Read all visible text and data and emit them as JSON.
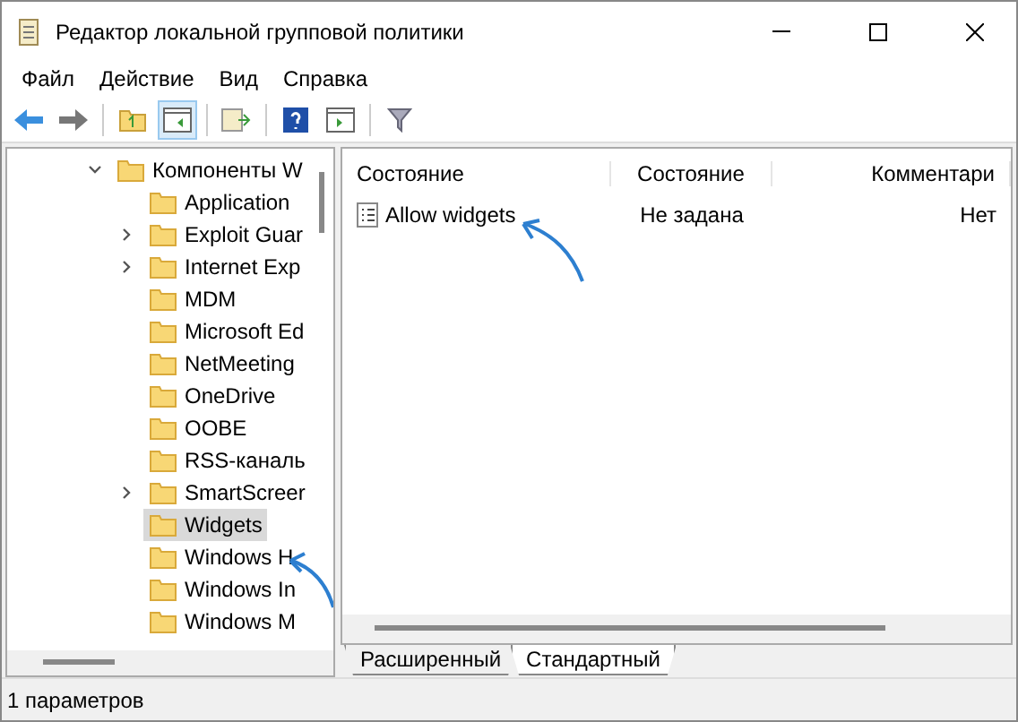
{
  "window": {
    "title": "Редактор локальной групповой политики"
  },
  "menu": [
    "Файл",
    "Действие",
    "Вид",
    "Справка"
  ],
  "tree": {
    "label": "Компоненты W",
    "expanded": true,
    "children": [
      {
        "label": "Application",
        "expandable": false,
        "selected": false
      },
      {
        "label": "Exploit Guar",
        "expandable": true,
        "selected": false
      },
      {
        "label": "Internet Exp",
        "expandable": true,
        "selected": false
      },
      {
        "label": "MDM",
        "expandable": false,
        "selected": false
      },
      {
        "label": "Microsoft Ed",
        "expandable": false,
        "selected": false
      },
      {
        "label": "NetMeeting",
        "expandable": false,
        "selected": false
      },
      {
        "label": "OneDrive",
        "expandable": false,
        "selected": false
      },
      {
        "label": "OOBE",
        "expandable": false,
        "selected": false
      },
      {
        "label": "RSS-каналь",
        "expandable": false,
        "selected": false
      },
      {
        "label": "SmartScreer",
        "expandable": true,
        "selected": false
      },
      {
        "label": "Widgets",
        "expandable": false,
        "selected": true
      },
      {
        "label": "Windows H",
        "expandable": false,
        "selected": false
      },
      {
        "label": "Windows In",
        "expandable": false,
        "selected": false
      },
      {
        "label": "Windows M",
        "expandable": false,
        "selected": false
      }
    ]
  },
  "table": {
    "columns": [
      "Состояние",
      "Состояние",
      "Комментари"
    ],
    "rows": [
      {
        "cells": [
          "Allow widgets",
          "Не задана",
          "Нет"
        ]
      }
    ]
  },
  "tabs": [
    {
      "label": "Расширенный",
      "selected": false
    },
    {
      "label": "Стандартный",
      "selected": true
    }
  ],
  "status_bar": "1 параметров"
}
